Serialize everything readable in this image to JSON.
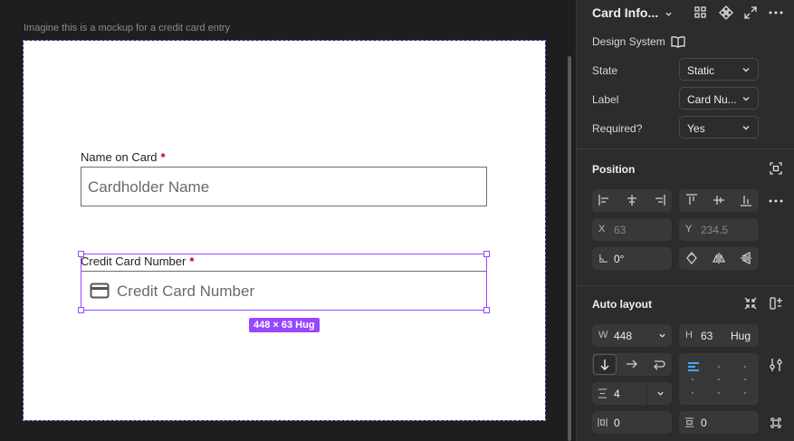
{
  "canvas": {
    "frame_label": "Imagine this is a mockup for a credit card entry",
    "fields": {
      "name_label": "Name on Card",
      "name_placeholder": "Cardholder Name",
      "card_label": "Credit Card Number",
      "card_placeholder": "Credit Card Number",
      "required_mark": "*"
    },
    "selection_badge": "448 × 63 Hug"
  },
  "panel": {
    "header": {
      "title": "Card Info...",
      "icons": [
        "grid-icon",
        "component-icon",
        "expand-icon",
        "more-icon"
      ]
    },
    "design_system": {
      "label": "Design System",
      "icon": "book-icon"
    },
    "properties": [
      {
        "label": "State",
        "value": "Static"
      },
      {
        "label": "Label",
        "value": "Card Nu..."
      },
      {
        "label": "Required?",
        "value": "Yes"
      }
    ],
    "position": {
      "title": "Position",
      "x_key": "X",
      "x_value": "63",
      "y_key": "Y",
      "y_value": "234.5",
      "rotation_value": "0°"
    },
    "auto_layout": {
      "title": "Auto layout",
      "w_key": "W",
      "w_value": "448",
      "h_key": "H",
      "h_value": "63",
      "h_mode": "Hug",
      "gap_value": "4",
      "pad_h_value": "0",
      "pad_v_value": "0"
    },
    "accent": "#9747ff"
  }
}
